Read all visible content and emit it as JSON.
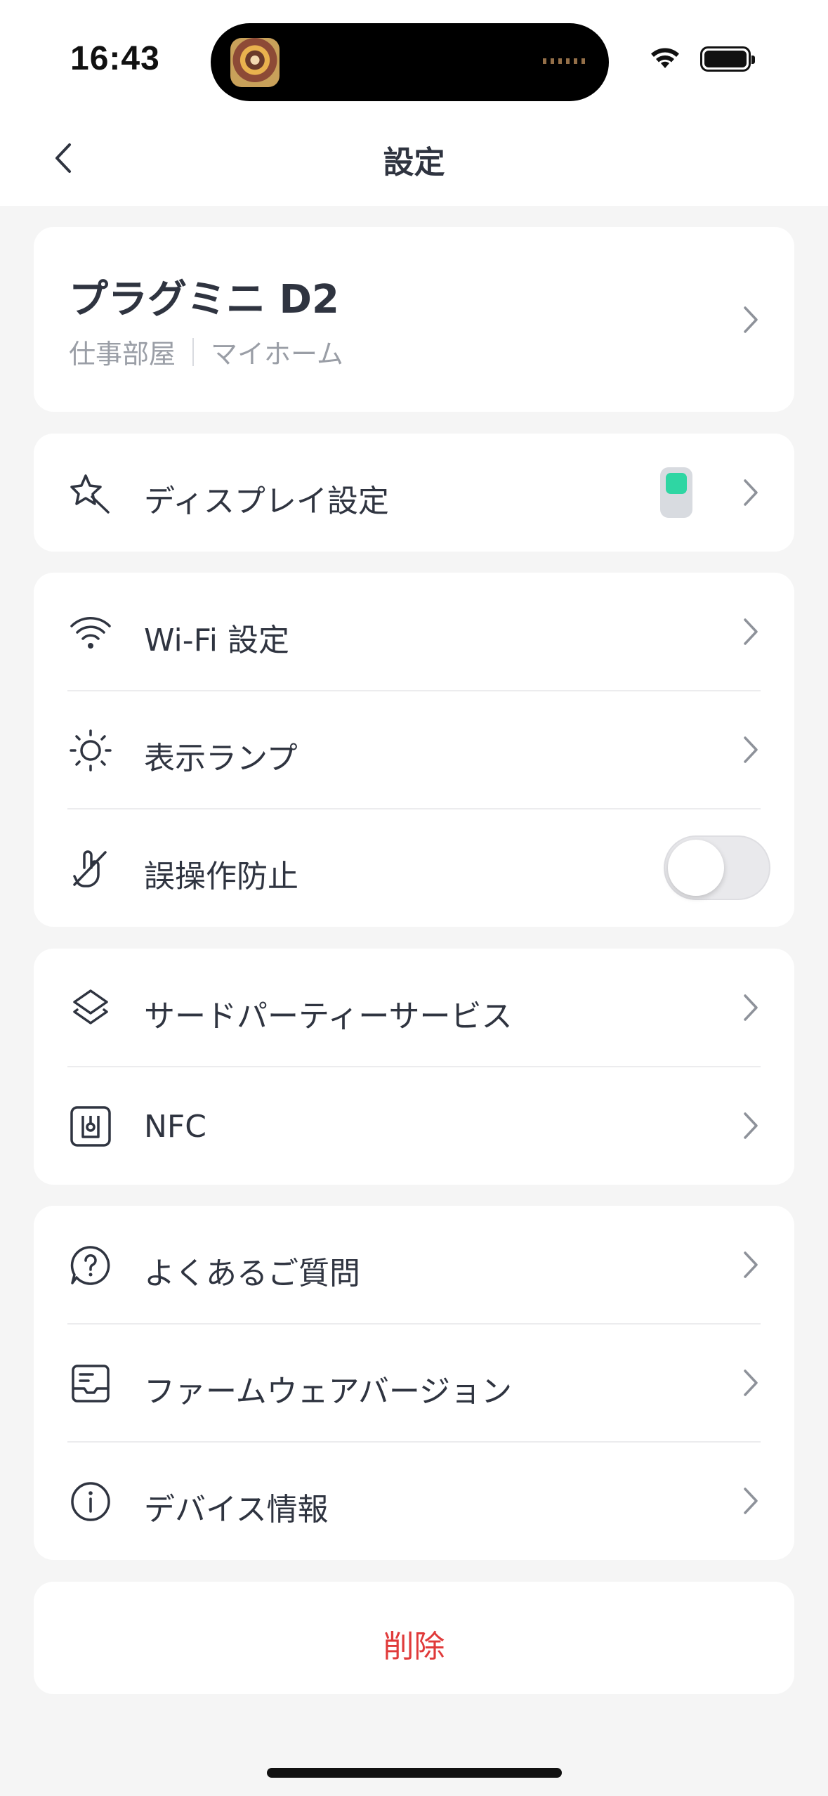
{
  "status_bar": {
    "time": "16:43"
  },
  "nav": {
    "title": "設定"
  },
  "device": {
    "name": "プラグミニ D2",
    "room": "仕事部屋",
    "home": "マイホーム"
  },
  "groups": {
    "display": {
      "label": "ディスプレイ設定",
      "icon": "magic-wand-icon"
    },
    "connectivity": [
      {
        "label": "Wi-Fi 設定",
        "icon": "wifi-icon"
      },
      {
        "label": "表示ランプ",
        "icon": "sun-icon"
      },
      {
        "label": "誤操作防止",
        "icon": "no-touch-icon",
        "toggle": false
      }
    ],
    "services": [
      {
        "label": "サードパーティーサービス",
        "icon": "layers-icon"
      },
      {
        "label": "NFC",
        "icon": "nfc-icon"
      }
    ],
    "info": [
      {
        "label": "よくあるご質問",
        "icon": "help-icon"
      },
      {
        "label": "ファームウェアバージョン",
        "icon": "firmware-icon"
      },
      {
        "label": "デバイス情報",
        "icon": "info-icon"
      }
    ]
  },
  "delete": {
    "label": "削除"
  },
  "colors": {
    "accent_green": "#2fd6a3",
    "danger": "#e03a3a",
    "text": "#2f3440",
    "subtext": "#9a9ea6"
  }
}
